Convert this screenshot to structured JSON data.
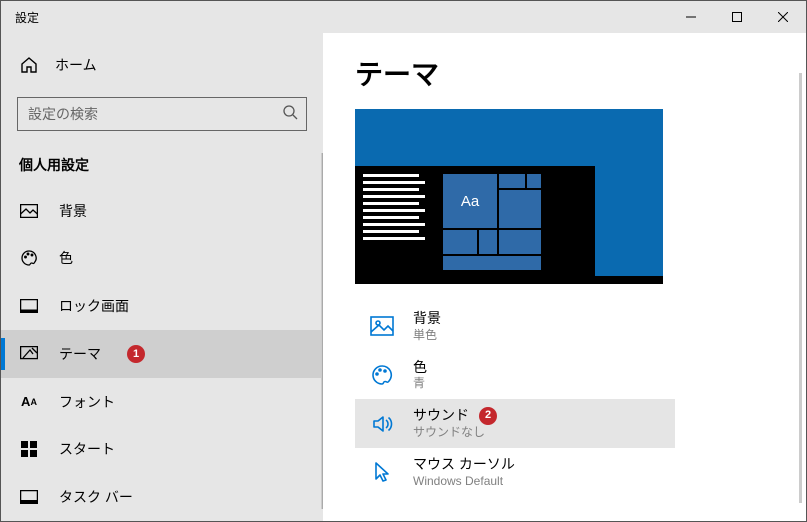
{
  "window_title": "設定",
  "home_label": "ホーム",
  "search_placeholder": "設定の検索",
  "section_header": "個人用設定",
  "nav": {
    "background": "背景",
    "color": "色",
    "lockscreen": "ロック画面",
    "themes": "テーマ",
    "fonts": "フォント",
    "start": "スタート",
    "taskbar": "タスク バー"
  },
  "badge1": "1",
  "badge2": "2",
  "page_title": "テーマ",
  "preview_tile_text": "Aa",
  "settings": {
    "background": {
      "label": "背景",
      "sub": "単色"
    },
    "color": {
      "label": "色",
      "sub": "青"
    },
    "sound": {
      "label": "サウンド",
      "sub": "サウンドなし"
    },
    "cursor": {
      "label": "マウス カーソル",
      "sub": "Windows Default"
    }
  }
}
